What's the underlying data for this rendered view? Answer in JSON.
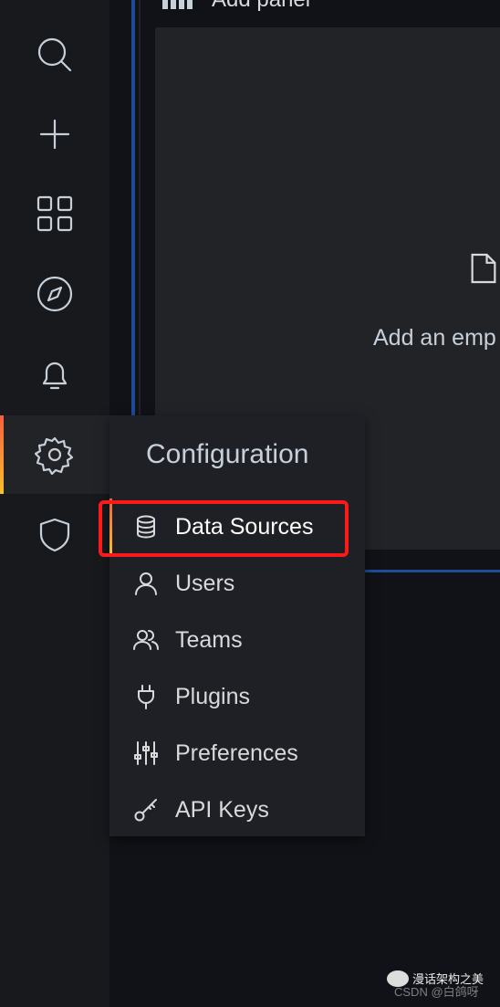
{
  "sidebar": {
    "items": [
      {
        "icon": "search-icon"
      },
      {
        "icon": "plus-icon"
      },
      {
        "icon": "dashboards-icon"
      },
      {
        "icon": "compass-icon"
      },
      {
        "icon": "bell-icon"
      },
      {
        "icon": "gear-icon",
        "active": true
      },
      {
        "icon": "shield-icon"
      }
    ]
  },
  "main": {
    "header": "Add panel",
    "empty_text": "Add an emp"
  },
  "menu": {
    "title": "Configuration",
    "items": [
      {
        "label": "Data Sources",
        "icon": "database-icon",
        "active": true
      },
      {
        "label": "Users",
        "icon": "user-icon"
      },
      {
        "label": "Teams",
        "icon": "users-icon"
      },
      {
        "label": "Plugins",
        "icon": "plug-icon"
      },
      {
        "label": "Preferences",
        "icon": "sliders-icon"
      },
      {
        "label": "API Keys",
        "icon": "key-icon"
      }
    ]
  },
  "watermark": {
    "line1": "漫话架构之美",
    "line2": "CSDN @白鸽呀"
  },
  "colors": {
    "accent_gradient": [
      "#f55f3e",
      "#fbc02d"
    ],
    "highlight_box": "#ff1a1a",
    "panel_border": "#1f4b99"
  }
}
